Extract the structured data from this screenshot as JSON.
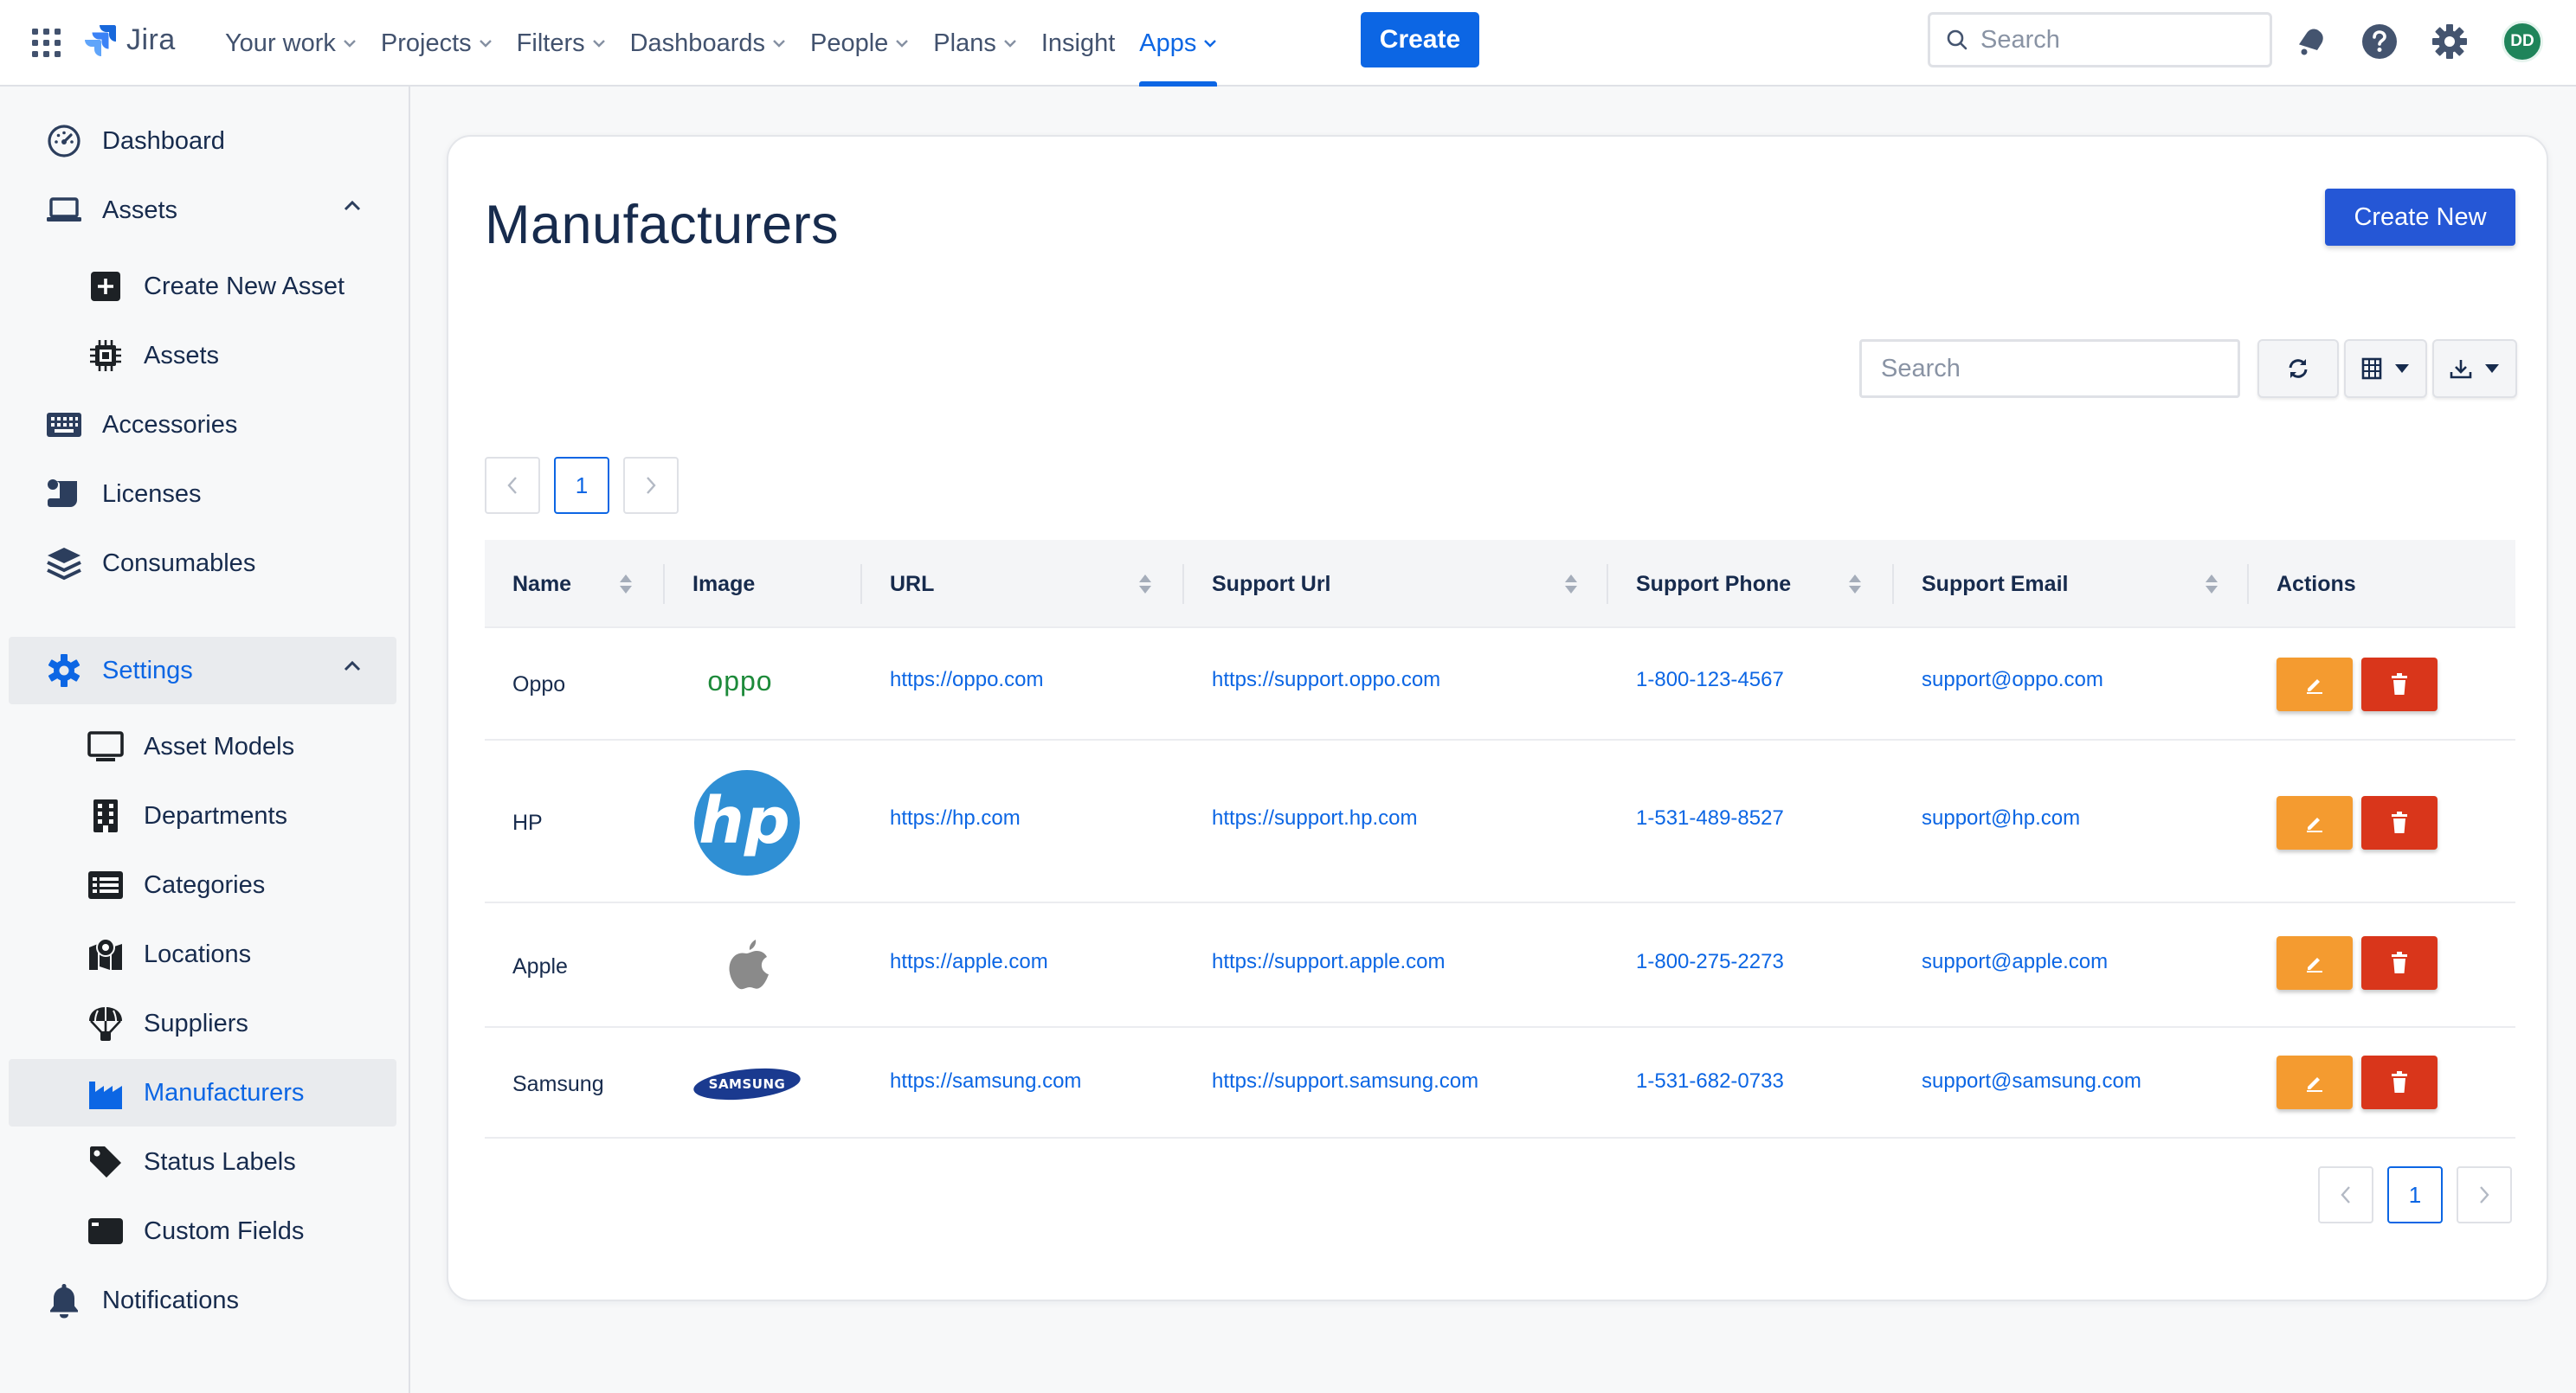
{
  "topnav": {
    "logo_text": "Jira",
    "items": [
      {
        "label": "Your work",
        "dropdown": true
      },
      {
        "label": "Projects",
        "dropdown": true
      },
      {
        "label": "Filters",
        "dropdown": true
      },
      {
        "label": "Dashboards",
        "dropdown": true
      },
      {
        "label": "People",
        "dropdown": true
      },
      {
        "label": "Plans",
        "dropdown": true
      },
      {
        "label": "Insight",
        "dropdown": false
      },
      {
        "label": "Apps",
        "dropdown": true,
        "active": true
      }
    ],
    "create_label": "Create",
    "search_placeholder": "Search",
    "avatar_initials": "DD",
    "icons": [
      "app-switcher-icon",
      "jira-logo-icon",
      "search-icon",
      "notifications-icon",
      "help-icon",
      "settings-icon"
    ]
  },
  "sidebar": {
    "items": [
      {
        "label": "Dashboard",
        "icon": "dashboard-icon"
      },
      {
        "label": "Assets",
        "icon": "laptop-icon",
        "expanded": true
      },
      {
        "label": "Create New Asset",
        "icon": "plus-square-icon"
      },
      {
        "label": "Assets",
        "icon": "chip-icon"
      },
      {
        "label": "Accessories",
        "icon": "keyboard-icon"
      },
      {
        "label": "Licenses",
        "icon": "scroll-icon"
      },
      {
        "label": "Consumables",
        "icon": "layers-icon"
      },
      {
        "label": "Settings",
        "icon": "gear-icon",
        "expanded": true
      },
      {
        "label": "Asset Models",
        "icon": "monitor-icon"
      },
      {
        "label": "Departments",
        "icon": "building-icon"
      },
      {
        "label": "Categories",
        "icon": "list-icon"
      },
      {
        "label": "Locations",
        "icon": "map-pin-icon"
      },
      {
        "label": "Suppliers",
        "icon": "parachute-icon"
      },
      {
        "label": "Manufacturers",
        "icon": "factory-icon",
        "selected": true
      },
      {
        "label": "Status Labels",
        "icon": "tag-icon"
      },
      {
        "label": "Custom Fields",
        "icon": "card-icon"
      },
      {
        "label": "Notifications",
        "icon": "bell-icon"
      }
    ]
  },
  "main": {
    "title": "Manufacturers",
    "create_new_label": "Create New",
    "search_placeholder": "Search",
    "pagination": {
      "current_page": "1"
    },
    "columns": [
      "Name",
      "Image",
      "URL",
      "Support Url",
      "Support Phone",
      "Support Email",
      "Actions"
    ],
    "rows": [
      {
        "name": "Oppo",
        "logo": "oppo-logo",
        "url": "https://oppo.com",
        "support_url": "https://support.oppo.com",
        "phone": "1-800-123-4567",
        "email": "support@oppo.com"
      },
      {
        "name": "HP",
        "logo": "hp-logo",
        "url": "https://hp.com",
        "support_url": "https://support.hp.com",
        "phone": "1-531-489-8527",
        "email": "support@hp.com"
      },
      {
        "name": "Apple",
        "logo": "apple-logo",
        "url": "https://apple.com",
        "support_url": "https://support.apple.com",
        "phone": "1-800-275-2273",
        "email": "support@apple.com"
      },
      {
        "name": "Samsung",
        "logo": "samsung-logo",
        "url": "https://samsung.com",
        "support_url": "https://support.samsung.com",
        "phone": "1-531-682-0733",
        "email": "support@samsung.com"
      }
    ],
    "logo_texts": {
      "oppo": "oppo",
      "hp": "hp",
      "samsung": "SAMSUNG"
    }
  },
  "colors": {
    "accent": "#0c66e4",
    "create_new": "#2557d6",
    "edit": "#f49b30",
    "delete": "#d9361b",
    "avatar": "#1f845a"
  }
}
